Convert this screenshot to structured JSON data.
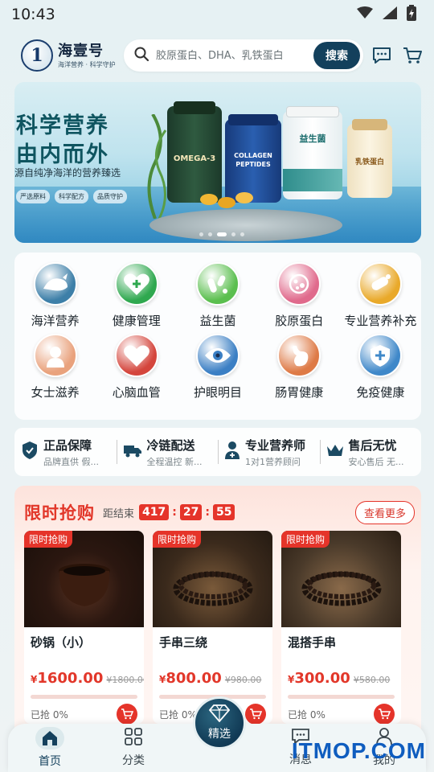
{
  "status": {
    "time": "10:43"
  },
  "header": {
    "logo_name": "海壹号",
    "logo_sub": "海洋营养 · 科学守护",
    "logo_mark": "1",
    "search_placeholder": "胶原蛋白、DHA、乳铁蛋白",
    "search_button": "搜索"
  },
  "banner": {
    "title1": "科学营养",
    "title2": "由内而外",
    "subtitle": "源自纯净海洋的营养臻选",
    "tags": [
      "严选原料",
      "科学配方",
      "品质守护"
    ],
    "jars": [
      "OMEGA-3",
      "COLLAGEN PEPTIDES",
      "益生菌",
      "乳铁蛋白"
    ],
    "dots": 5,
    "active_dot": 3
  },
  "categories": [
    {
      "label": "海洋营养",
      "icon": "whale-icon",
      "color": "#3d7fa8"
    },
    {
      "label": "健康管理",
      "icon": "heart-cross-icon",
      "color": "#2fa84f"
    },
    {
      "label": "益生菌",
      "icon": "probiotic-icon",
      "color": "#5bbf4f"
    },
    {
      "label": "胶原蛋白",
      "icon": "collagen-icon",
      "color": "#e06a8c"
    },
    {
      "label": "专业营养补充",
      "icon": "capsule-icon",
      "color": "#e9a92a"
    },
    {
      "label": "女士滋养",
      "icon": "woman-icon",
      "color": "#e9a27d"
    },
    {
      "label": "心脑血管",
      "icon": "heart-icon",
      "color": "#d4453c"
    },
    {
      "label": "护眼明目",
      "icon": "eye-icon",
      "color": "#3b7fc4"
    },
    {
      "label": "肠胃健康",
      "icon": "stomach-icon",
      "color": "#de7a46"
    },
    {
      "label": "免疫健康",
      "icon": "immune-icon",
      "color": "#3f88c9"
    }
  ],
  "guarantees": [
    {
      "title": "正品保障",
      "sub": "品牌直供 假...",
      "icon": "shield-check-icon"
    },
    {
      "title": "冷链配送",
      "sub": "全程温控 新...",
      "icon": "truck-icon"
    },
    {
      "title": "专业营养师",
      "sub": "1对1营养顾问",
      "icon": "nutritionist-icon"
    },
    {
      "title": "售后无忧",
      "sub": "安心售后 无...",
      "icon": "crown-icon"
    }
  ],
  "flash_sale": {
    "title": "限时抢购",
    "ends_label": "距结束",
    "countdown": {
      "hours": "417",
      "minutes": "27",
      "seconds": "55"
    },
    "see_more": "查看更多",
    "products": [
      {
        "badge": "限时抢购",
        "name": "砂锅（小）",
        "currency": "¥",
        "price": "1600.00",
        "old_price": "¥1800.00",
        "sold": "已抢 0%",
        "progress": 0
      },
      {
        "badge": "限时抢购",
        "name": "手串三绕",
        "currency": "¥",
        "price": "800.00",
        "old_price": "¥980.00",
        "sold": "已抢 0%",
        "progress": 0
      },
      {
        "badge": "限时抢购",
        "name": "混搭手串",
        "currency": "¥",
        "price": "300.00",
        "old_price": "¥580.00",
        "sold": "已抢 0%",
        "progress": 0
      }
    ]
  },
  "tabbar": {
    "home": "首页",
    "category": "分类",
    "featured": "精选",
    "messages": "消息",
    "mine": "我的"
  },
  "watermark": "ITMOP.COM"
}
